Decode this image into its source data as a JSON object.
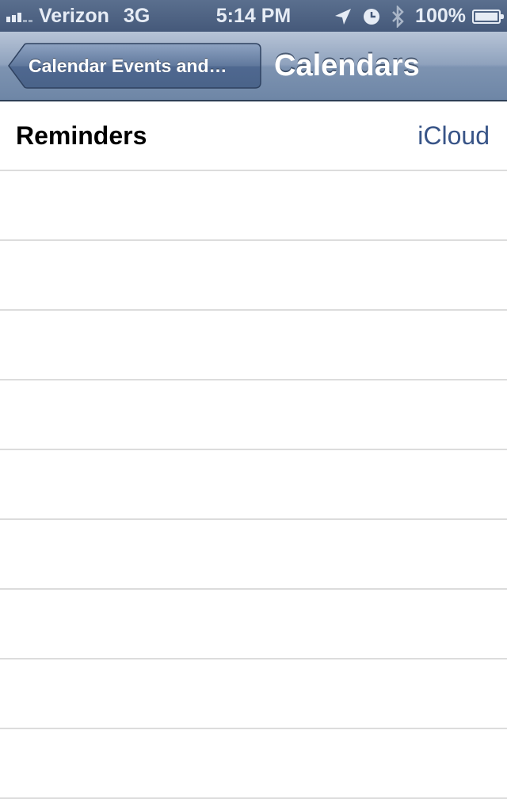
{
  "status_bar": {
    "carrier": "Verizon",
    "network": "3G",
    "time": "5:14 PM",
    "battery_percent": "100%",
    "icons": [
      "signal-icon",
      "location-arrow-icon",
      "alarm-clock-icon",
      "bluetooth-icon",
      "battery-charging-icon"
    ]
  },
  "nav_bar": {
    "back_label": "Calendar Events and…",
    "title": "Calendars"
  },
  "table": {
    "rows": [
      {
        "title": "Reminders",
        "detail": "iCloud"
      },
      {
        "title": "",
        "detail": ""
      },
      {
        "title": "",
        "detail": ""
      },
      {
        "title": "",
        "detail": ""
      },
      {
        "title": "",
        "detail": ""
      },
      {
        "title": "",
        "detail": ""
      },
      {
        "title": "",
        "detail": ""
      },
      {
        "title": "",
        "detail": ""
      },
      {
        "title": "",
        "detail": ""
      },
      {
        "title": "",
        "detail": ""
      }
    ]
  },
  "colors": {
    "nav_bar": "#7d93b1",
    "status_bar": "#45597a",
    "detail_text": "#385487",
    "separator": "#dcdcdc"
  }
}
